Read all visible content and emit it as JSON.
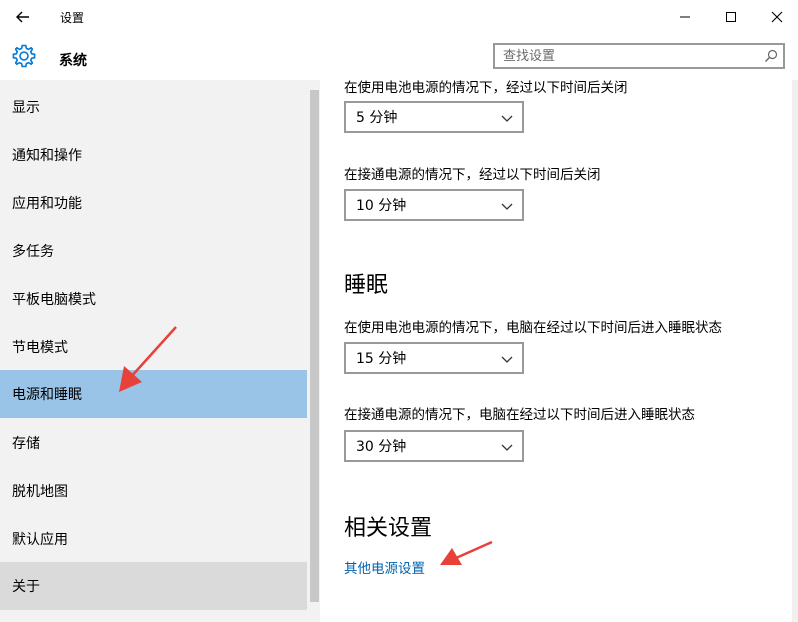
{
  "window": {
    "title": "设置"
  },
  "header": {
    "section": "系统",
    "search_placeholder": "查找设置"
  },
  "sidebar": {
    "items": [
      {
        "label": "显示"
      },
      {
        "label": "通知和操作"
      },
      {
        "label": "应用和功能"
      },
      {
        "label": "多任务"
      },
      {
        "label": "平板电脑模式"
      },
      {
        "label": "节电模式"
      },
      {
        "label": "电源和睡眠"
      },
      {
        "label": "存储"
      },
      {
        "label": "脱机地图"
      },
      {
        "label": "默认应用"
      },
      {
        "label": "关于"
      }
    ],
    "selected": "电源和睡眠"
  },
  "screen": {
    "battery_label": "在使用电池电源的情况下，经过以下时间后关闭",
    "battery_value": "5 分钟",
    "plugged_label": "在接通电源的情况下，经过以下时间后关闭",
    "plugged_value": "10 分钟"
  },
  "sleep": {
    "heading": "睡眠",
    "battery_label": "在使用电池电源的情况下，电脑在经过以下时间后进入睡眠状态",
    "battery_value": "15 分钟",
    "plugged_label": "在接通电源的情况下，电脑在经过以下时间后进入睡眠状态",
    "plugged_value": "30 分钟"
  },
  "related": {
    "heading": "相关设置",
    "link": "其他电源设置"
  },
  "colors": {
    "accent": "#0078d7",
    "selected_bg": "#99c4e8",
    "link": "#0063b1",
    "annotation": "#e8413a"
  },
  "icons": {
    "back": "back-arrow-icon",
    "gear": "gear-icon",
    "search": "search-icon",
    "minimize": "minimize-icon",
    "maximize": "maximize-icon",
    "close": "close-icon",
    "chevron": "chevron-down-icon"
  }
}
